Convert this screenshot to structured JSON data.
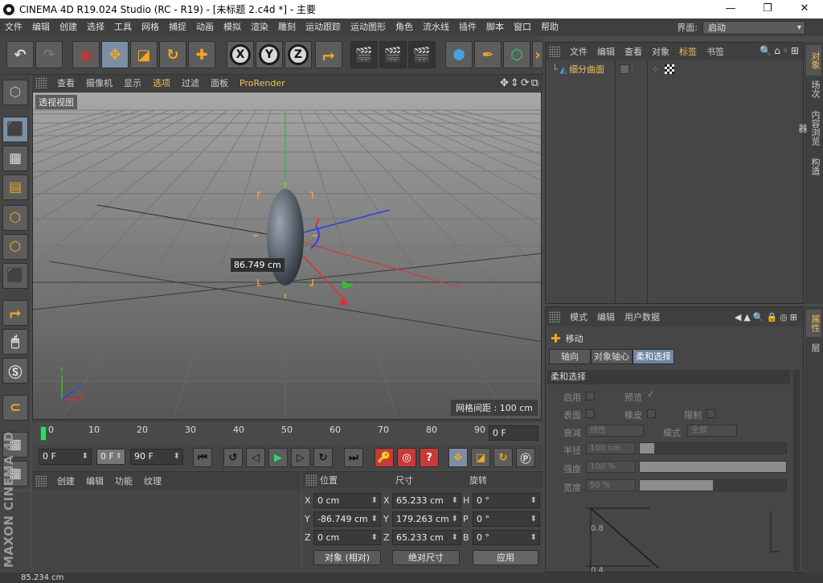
{
  "window": {
    "title": "CINEMA 4D R19.024 Studio (RC - R19) - [未标题 2.c4d *] - 主要"
  },
  "menu": [
    "文件",
    "编辑",
    "创建",
    "选择",
    "工具",
    "网格",
    "捕捉",
    "动画",
    "模拟",
    "渲染",
    "雕刻",
    "运动跟踪",
    "运动图形",
    "角色",
    "流水线",
    "插件",
    "脚本",
    "窗口",
    "帮助"
  ],
  "layout": {
    "label": "界面:",
    "value": "启动"
  },
  "viewport": {
    "menu": [
      "查看",
      "摄像机",
      "显示",
      "选项",
      "过滤",
      "面板",
      "ProRender"
    ],
    "name": "透视视图",
    "measure": "86.749 cm",
    "grid_info": "网格间距 : 100 cm"
  },
  "timeline": {
    "ticks": [
      "0",
      "10",
      "20",
      "30",
      "40",
      "50",
      "60",
      "70",
      "80",
      "90"
    ],
    "current": "0 F"
  },
  "transport": {
    "start": "0 F",
    "preview_start": "0 F",
    "end": "90 F"
  },
  "material": {
    "menu": [
      "创建",
      "编辑",
      "功能",
      "纹理"
    ]
  },
  "coords": {
    "headers": [
      "位置",
      "尺寸",
      "旋转"
    ],
    "rows": [
      {
        "axis": "X",
        "pos": "0 cm",
        "size_axis": "X",
        "size": "65.233 cm",
        "rot_axis": "H",
        "rot": "0 °"
      },
      {
        "axis": "Y",
        "pos": "-86.749 cm",
        "size_axis": "Y",
        "size": "179.263 cm",
        "rot_axis": "P",
        "rot": "0 °"
      },
      {
        "axis": "Z",
        "pos": "0 cm",
        "size_axis": "Z",
        "size": "65.233 cm",
        "rot_axis": "B",
        "rot": "0 °"
      }
    ],
    "mode": "对象 (相对)",
    "size_mode": "绝对尺寸",
    "apply": "应用"
  },
  "objects": {
    "menu": [
      "文件",
      "编辑",
      "查看",
      "对象",
      "标签",
      "书签"
    ],
    "item": "细分曲面"
  },
  "object_tabs": [
    "对象",
    "场次",
    "内容浏览器",
    "构造"
  ],
  "attributes": {
    "menu": [
      "模式",
      "编辑",
      "用户数据"
    ],
    "tool": "移动",
    "tabs": [
      "轴向",
      "对象轴心",
      "柔和选择"
    ],
    "section": "柔和选择",
    "enable": "启用",
    "preview": "预览",
    "surface": "表面",
    "rubber": "橡皮",
    "limit": "限制",
    "falloff": "衰减",
    "falloff_value": "线性",
    "mode": "模式",
    "mode_value": "全部",
    "radius": "半径",
    "radius_value": "100 cm",
    "strength": "强度",
    "strength_value": "100 %",
    "strength_fraction": 1.0,
    "width": "宽度",
    "width_value": "50 %",
    "width_fraction": 0.5,
    "graph_labels": [
      "0.8",
      "0.4"
    ]
  },
  "attr_tabs": [
    "属性",
    "层"
  ],
  "brand": "MAXON CINEMA 4D",
  "status": "85.234 cm"
}
